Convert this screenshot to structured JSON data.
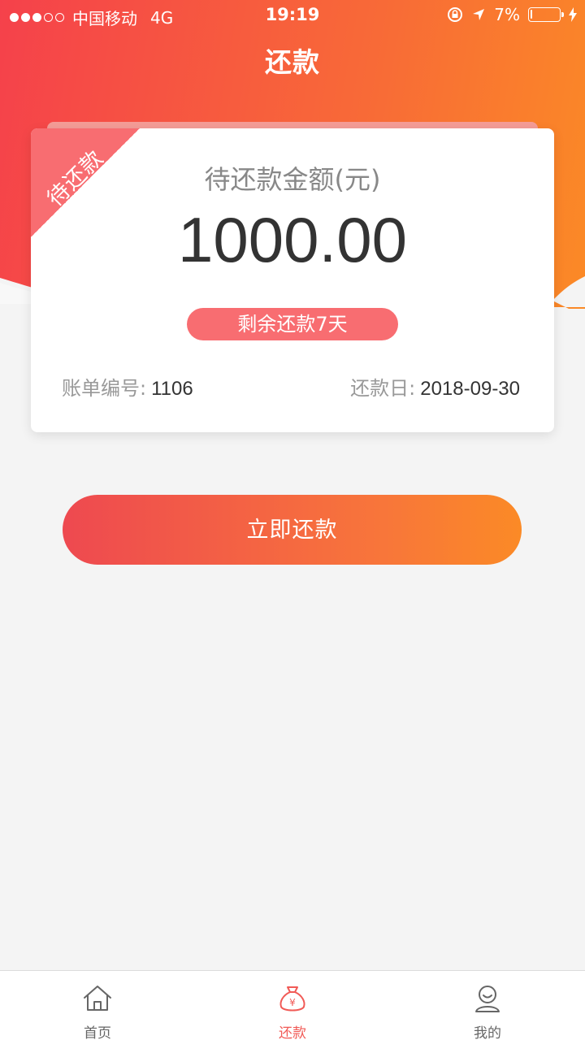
{
  "status_bar": {
    "carrier": "中国移动",
    "network": "4G",
    "time": "19:19",
    "battery_text": "7%",
    "battery_level": 0.07
  },
  "nav": {
    "title": "还款"
  },
  "card": {
    "ribbon": "待还款",
    "amount_label": "待还款金额(元)",
    "amount": "1000.00",
    "remaining": "剩余还款7天",
    "bill_label": "账单编号:",
    "bill_no": "1106",
    "due_label": "还款日:",
    "due_date": "2018-09-30"
  },
  "actions": {
    "repay_label": "立即还款"
  },
  "tabs": [
    {
      "label": "首页",
      "icon": "home-icon",
      "active": false
    },
    {
      "label": "还款",
      "icon": "money-bag-icon",
      "active": true
    },
    {
      "label": "我的",
      "icon": "user-icon",
      "active": false
    }
  ],
  "colors": {
    "accent": "#f15a56",
    "gradient_start": "#f5414b",
    "gradient_end": "#fb8a26",
    "badge": "#f86d71"
  }
}
